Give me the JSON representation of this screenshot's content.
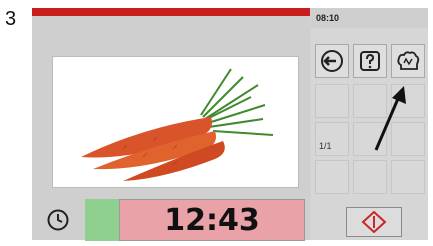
{
  "step_number": "3",
  "status": {
    "time": "08:10"
  },
  "timer": {
    "value": "12:43"
  },
  "grid": {
    "page_indicator": "1/1"
  },
  "icons": {
    "back": "back-arrow-icon",
    "help": "help-icon",
    "chef": "chef-hat-icon",
    "clock": "clock-icon",
    "start": "start-stop-icon"
  },
  "colors": {
    "progress_bar": "#c81e1e",
    "timer_background": "#e8a2a8",
    "timer_elapsed": "#8fcf8f",
    "start_icon": "#c82828"
  }
}
